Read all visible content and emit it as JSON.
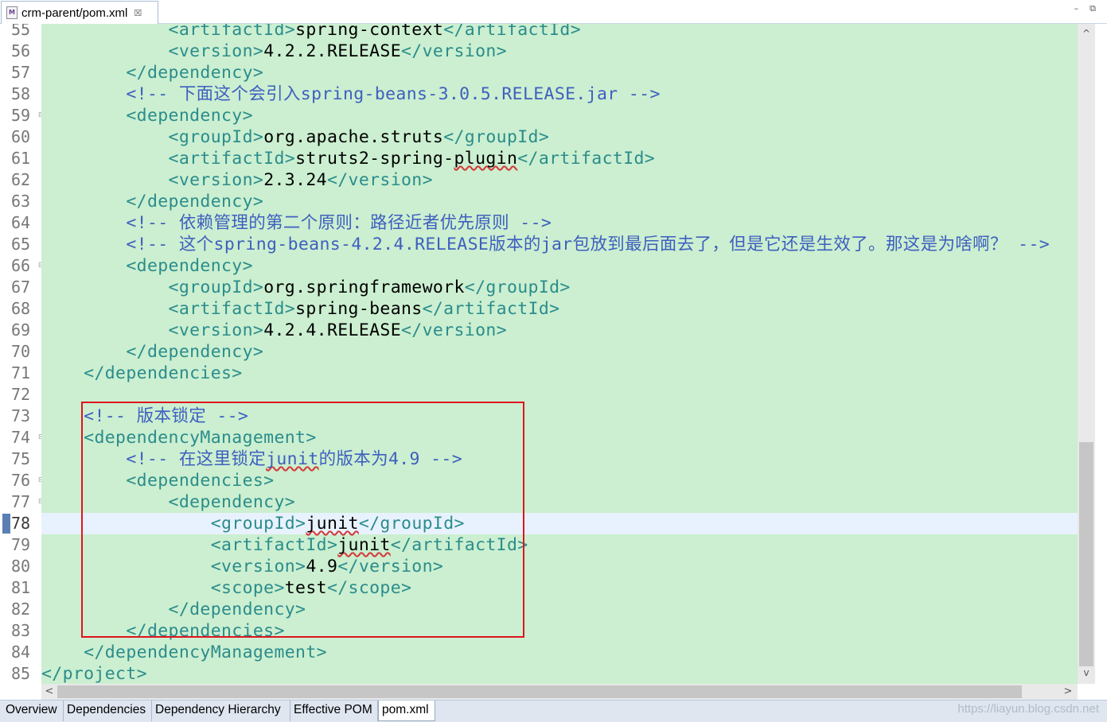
{
  "editor_tab": {
    "title": "crm-parent/pom.xml",
    "file_icon": "maven-pom-file-icon",
    "close_glyph": "☒"
  },
  "window_controls": {
    "minimize": "–",
    "restore": "⧉"
  },
  "active_line": "78",
  "lines": [
    {
      "num": "55",
      "fold": false,
      "tokens": [
        {
          "t": "t",
          "s": "            <artifactId>"
        },
        {
          "t": "v",
          "s": "spring-context"
        },
        {
          "t": "t",
          "s": "</artifactId>"
        }
      ]
    },
    {
      "num": "56",
      "fold": false,
      "tokens": [
        {
          "t": "t",
          "s": "            <version>"
        },
        {
          "t": "v",
          "s": "4.2.2.RELEASE"
        },
        {
          "t": "t",
          "s": "</version>"
        }
      ]
    },
    {
      "num": "57",
      "fold": false,
      "tokens": [
        {
          "t": "t",
          "s": "        </dependency>"
        }
      ]
    },
    {
      "num": "58",
      "fold": false,
      "tokens": [
        {
          "t": "c",
          "s": "        <!-- 下面这个会引入spring-beans-3.0.5.RELEASE.jar -->"
        }
      ]
    },
    {
      "num": "59",
      "fold": true,
      "tokens": [
        {
          "t": "t",
          "s": "        <dependency>"
        }
      ]
    },
    {
      "num": "60",
      "fold": false,
      "tokens": [
        {
          "t": "t",
          "s": "            <groupId>"
        },
        {
          "t": "v",
          "s": "org.apache.struts"
        },
        {
          "t": "t",
          "s": "</groupId>"
        }
      ]
    },
    {
      "num": "61",
      "fold": false,
      "tokens": [
        {
          "t": "t",
          "s": "            <artifactId>"
        },
        {
          "t": "v",
          "s": "struts2-spring-"
        },
        {
          "t": "vsq",
          "s": "plugin"
        },
        {
          "t": "t",
          "s": "</artifactId>"
        }
      ]
    },
    {
      "num": "62",
      "fold": false,
      "tokens": [
        {
          "t": "t",
          "s": "            <version>"
        },
        {
          "t": "v",
          "s": "2.3.24"
        },
        {
          "t": "t",
          "s": "</version>"
        }
      ]
    },
    {
      "num": "63",
      "fold": false,
      "tokens": [
        {
          "t": "t",
          "s": "        </dependency>"
        }
      ]
    },
    {
      "num": "64",
      "fold": false,
      "tokens": [
        {
          "t": "c",
          "s": "        <!-- 依赖管理的第二个原则：路径近者优先原则 -->"
        }
      ]
    },
    {
      "num": "65",
      "fold": false,
      "tokens": [
        {
          "t": "c",
          "s": "        <!-- 这个spring-beans-4.2.4.RELEASE版本的jar包放到最后面去了，但是它还是生效了。那这是为啥啊？ -->"
        }
      ]
    },
    {
      "num": "66",
      "fold": true,
      "tokens": [
        {
          "t": "t",
          "s": "        <dependency>"
        }
      ]
    },
    {
      "num": "67",
      "fold": false,
      "tokens": [
        {
          "t": "t",
          "s": "            <groupId>"
        },
        {
          "t": "v",
          "s": "org.springframework"
        },
        {
          "t": "t",
          "s": "</groupId>"
        }
      ]
    },
    {
      "num": "68",
      "fold": false,
      "tokens": [
        {
          "t": "t",
          "s": "            <artifactId>"
        },
        {
          "t": "v",
          "s": "spring-beans"
        },
        {
          "t": "t",
          "s": "</artifactId>"
        }
      ]
    },
    {
      "num": "69",
      "fold": false,
      "tokens": [
        {
          "t": "t",
          "s": "            <version>"
        },
        {
          "t": "v",
          "s": "4.2.4.RELEASE"
        },
        {
          "t": "t",
          "s": "</version>"
        }
      ]
    },
    {
      "num": "70",
      "fold": false,
      "tokens": [
        {
          "t": "t",
          "s": "        </dependency>"
        }
      ]
    },
    {
      "num": "71",
      "fold": false,
      "tokens": [
        {
          "t": "t",
          "s": "    </dependencies>"
        }
      ]
    },
    {
      "num": "72",
      "fold": false,
      "tokens": []
    },
    {
      "num": "73",
      "fold": false,
      "tokens": [
        {
          "t": "c",
          "s": "    <!-- 版本锁定 -->"
        }
      ]
    },
    {
      "num": "74",
      "fold": true,
      "tokens": [
        {
          "t": "t",
          "s": "    <dependencyManagement>"
        }
      ]
    },
    {
      "num": "75",
      "fold": false,
      "tokens": [
        {
          "t": "c",
          "s": "        <!-- 在这里锁定"
        },
        {
          "t": "csq",
          "s": "junit"
        },
        {
          "t": "c",
          "s": "的版本为4.9 -->"
        }
      ]
    },
    {
      "num": "76",
      "fold": true,
      "tokens": [
        {
          "t": "t",
          "s": "        <dependencies>"
        }
      ]
    },
    {
      "num": "77",
      "fold": true,
      "tokens": [
        {
          "t": "t",
          "s": "            <dependency>"
        }
      ]
    },
    {
      "num": "78",
      "fold": false,
      "tokens": [
        {
          "t": "t",
          "s": "                <groupId>"
        },
        {
          "t": "vsq",
          "s": "junit"
        },
        {
          "t": "t",
          "s": "</groupId>"
        }
      ]
    },
    {
      "num": "79",
      "fold": false,
      "tokens": [
        {
          "t": "t",
          "s": "                <artifactId>"
        },
        {
          "t": "vsq",
          "s": "junit"
        },
        {
          "t": "t",
          "s": "</artifactId>"
        }
      ]
    },
    {
      "num": "80",
      "fold": false,
      "tokens": [
        {
          "t": "t",
          "s": "                <version>"
        },
        {
          "t": "v",
          "s": "4.9"
        },
        {
          "t": "t",
          "s": "</version>"
        }
      ]
    },
    {
      "num": "81",
      "fold": false,
      "tokens": [
        {
          "t": "t",
          "s": "                <scope>"
        },
        {
          "t": "v",
          "s": "test"
        },
        {
          "t": "t",
          "s": "</scope>"
        }
      ]
    },
    {
      "num": "82",
      "fold": false,
      "tokens": [
        {
          "t": "t",
          "s": "            </dependency>"
        }
      ]
    },
    {
      "num": "83",
      "fold": false,
      "tokens": [
        {
          "t": "t",
          "s": "        </dependencies>"
        }
      ]
    },
    {
      "num": "84",
      "fold": false,
      "tokens": [
        {
          "t": "t",
          "s": "    </dependencyManagement>"
        }
      ]
    },
    {
      "num": "85",
      "fold": false,
      "tokens": [
        {
          "t": "t",
          "s": "</project>"
        }
      ]
    }
  ],
  "scroll_glyphs": {
    "up": "^",
    "down": "v",
    "left": "<",
    "right": ">"
  },
  "bottom_tabs": [
    {
      "label": "Overview",
      "active": false
    },
    {
      "label": "Dependencies",
      "active": false
    },
    {
      "label": "Dependency Hierarchy",
      "active": false
    },
    {
      "label": "Effective POM",
      "active": false
    },
    {
      "label": "pom.xml",
      "active": true
    }
  ],
  "watermark": "https://liayun.blog.csdn.net",
  "colors": {
    "editor_background": "#cbefd0",
    "current_line": "#e8f2fe",
    "xml_tag": "#2b8c8c",
    "xml_comment": "#3f5fbf",
    "xml_content": "#000000",
    "highlight_box_border": "#e0141e"
  }
}
